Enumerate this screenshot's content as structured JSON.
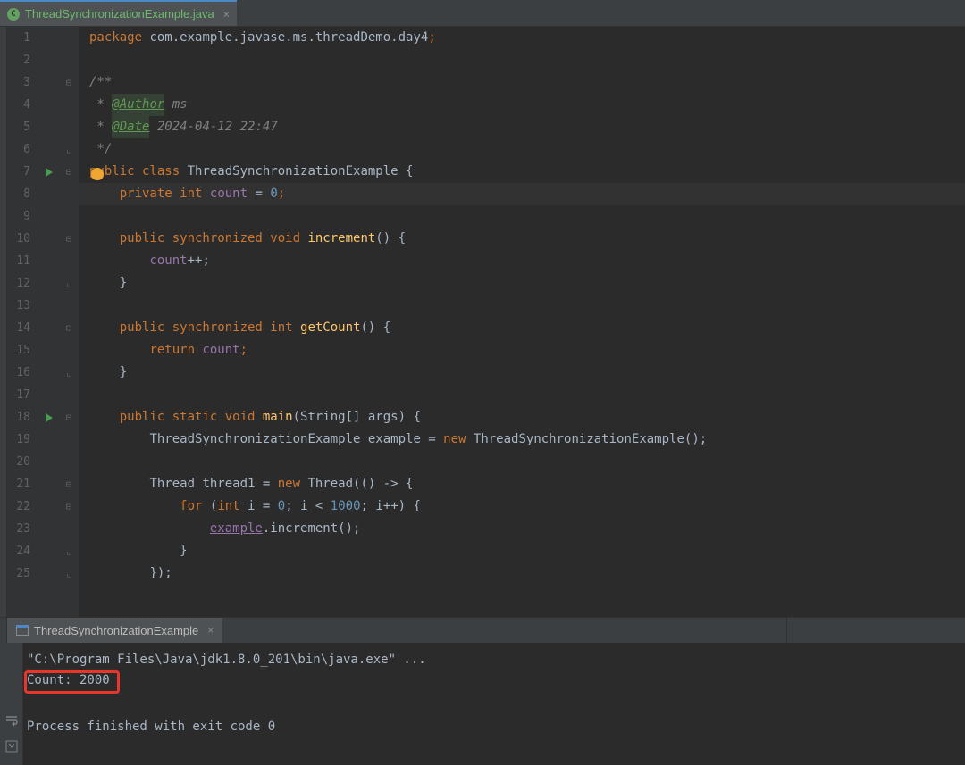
{
  "tab": {
    "name": "ThreadSynchronizationExample.java",
    "icon": "C"
  },
  "code": {
    "lines": [
      {
        "n": 1,
        "marker": "",
        "tokens": [
          {
            "c": "kw",
            "t": "package "
          },
          {
            "c": "ident",
            "t": "com.example.javase.ms.threadDemo.day4"
          },
          {
            "c": "kw",
            "t": ";"
          }
        ]
      },
      {
        "n": 2,
        "marker": "",
        "tokens": []
      },
      {
        "n": 3,
        "marker": "fold",
        "tokens": [
          {
            "c": "comment",
            "t": "/**"
          }
        ]
      },
      {
        "n": 4,
        "marker": "",
        "tokens": [
          {
            "c": "comment",
            "t": " * "
          },
          {
            "c": "comment-tag",
            "t": "@Author"
          },
          {
            "c": "comment-val",
            "t": " ms"
          }
        ]
      },
      {
        "n": 5,
        "marker": "",
        "tokens": [
          {
            "c": "comment",
            "t": " * "
          },
          {
            "c": "comment-tag",
            "t": "@Date"
          },
          {
            "c": "comment-val",
            "t": " 2024-04-12 22:47"
          }
        ]
      },
      {
        "n": 6,
        "marker": "foldend",
        "tokens": [
          {
            "c": "comment",
            "t": " */"
          }
        ]
      },
      {
        "n": 7,
        "marker": "run",
        "bulb": true,
        "tokens": [
          {
            "c": "kw",
            "t": "public class "
          },
          {
            "c": "ident",
            "t": "ThreadSynchronizationExample {"
          }
        ]
      },
      {
        "n": 8,
        "marker": "",
        "current": true,
        "indent": 1,
        "tokens": [
          {
            "c": "kw",
            "t": "private"
          },
          {
            "c": "ident",
            "t": " "
          },
          {
            "c": "kw",
            "t": "int "
          },
          {
            "c": "field",
            "t": "count"
          },
          {
            "c": "ident",
            "t": " = "
          },
          {
            "c": "num",
            "t": "0"
          },
          {
            "c": "kw",
            "t": ";"
          }
        ]
      },
      {
        "n": 9,
        "marker": "",
        "indent": 1,
        "tokens": []
      },
      {
        "n": 10,
        "marker": "fold",
        "indent": 1,
        "tokens": [
          {
            "c": "kw",
            "t": "public synchronized void "
          },
          {
            "c": "method",
            "t": "increment"
          },
          {
            "c": "ident",
            "t": "() {"
          }
        ]
      },
      {
        "n": 11,
        "marker": "",
        "indent": 2,
        "tokens": [
          {
            "c": "field",
            "t": "count"
          },
          {
            "c": "ident",
            "t": "++;"
          }
        ]
      },
      {
        "n": 12,
        "marker": "foldend",
        "indent": 1,
        "tokens": [
          {
            "c": "ident",
            "t": "}"
          }
        ]
      },
      {
        "n": 13,
        "marker": "",
        "indent": 1,
        "tokens": []
      },
      {
        "n": 14,
        "marker": "fold",
        "indent": 1,
        "tokens": [
          {
            "c": "kw",
            "t": "public synchronized int "
          },
          {
            "c": "method",
            "t": "getCount"
          },
          {
            "c": "ident",
            "t": "() {"
          }
        ]
      },
      {
        "n": 15,
        "marker": "",
        "indent": 2,
        "tokens": [
          {
            "c": "kw",
            "t": "return "
          },
          {
            "c": "field",
            "t": "count"
          },
          {
            "c": "kw",
            "t": ";"
          }
        ]
      },
      {
        "n": 16,
        "marker": "foldend",
        "indent": 1,
        "tokens": [
          {
            "c": "ident",
            "t": "}"
          }
        ]
      },
      {
        "n": 17,
        "marker": "",
        "indent": 1,
        "tokens": []
      },
      {
        "n": 18,
        "marker": "run",
        "indent": 1,
        "tokens": [
          {
            "c": "kw",
            "t": "public static void "
          },
          {
            "c": "method",
            "t": "main"
          },
          {
            "c": "ident",
            "t": "(String[] args) {"
          }
        ]
      },
      {
        "n": 19,
        "marker": "",
        "indent": 2,
        "tokens": [
          {
            "c": "ident",
            "t": "ThreadSynchronizationExample example = "
          },
          {
            "c": "kw",
            "t": "new "
          },
          {
            "c": "ident",
            "t": "ThreadSynchronizationExample();"
          }
        ]
      },
      {
        "n": 20,
        "marker": "",
        "indent": 2,
        "tokens": []
      },
      {
        "n": 21,
        "marker": "fold",
        "indent": 2,
        "tokens": [
          {
            "c": "ident",
            "t": "Thread thread1 = "
          },
          {
            "c": "kw",
            "t": "new "
          },
          {
            "c": "ident",
            "t": "Thread(() -> {"
          }
        ]
      },
      {
        "n": 22,
        "marker": "fold",
        "indent": 3,
        "tokens": [
          {
            "c": "kw",
            "t": "for "
          },
          {
            "c": "ident",
            "t": "("
          },
          {
            "c": "kw",
            "t": "int "
          },
          {
            "c": "ident underline",
            "t": "i"
          },
          {
            "c": "ident",
            "t": " = "
          },
          {
            "c": "num",
            "t": "0"
          },
          {
            "c": "ident",
            "t": "; "
          },
          {
            "c": "ident underline",
            "t": "i"
          },
          {
            "c": "ident",
            "t": " < "
          },
          {
            "c": "num",
            "t": "1000"
          },
          {
            "c": "ident",
            "t": "; "
          },
          {
            "c": "ident underline",
            "t": "i"
          },
          {
            "c": "ident",
            "t": "++) {"
          }
        ]
      },
      {
        "n": 23,
        "marker": "",
        "indent": 4,
        "tokens": [
          {
            "c": "field underline",
            "t": "example"
          },
          {
            "c": "ident",
            "t": ".increment();"
          }
        ]
      },
      {
        "n": 24,
        "marker": "foldend",
        "indent": 3,
        "tokens": [
          {
            "c": "ident",
            "t": "}"
          }
        ]
      },
      {
        "n": 25,
        "marker": "foldend",
        "indent": 2,
        "tokens": [
          {
            "c": "ident",
            "t": "});"
          }
        ]
      }
    ]
  },
  "console": {
    "tab_name": "ThreadSynchronizationExample",
    "lines": [
      {
        "text": "\"C:\\Program Files\\Java\\jdk1.8.0_201\\bin\\java.exe\" ...",
        "highlight": false
      },
      {
        "text": "Count: 2000",
        "highlight": true
      },
      {
        "text": "",
        "highlight": false
      },
      {
        "text": "Process finished with exit code 0",
        "highlight": false
      },
      {
        "text": "",
        "highlight": false
      }
    ]
  }
}
